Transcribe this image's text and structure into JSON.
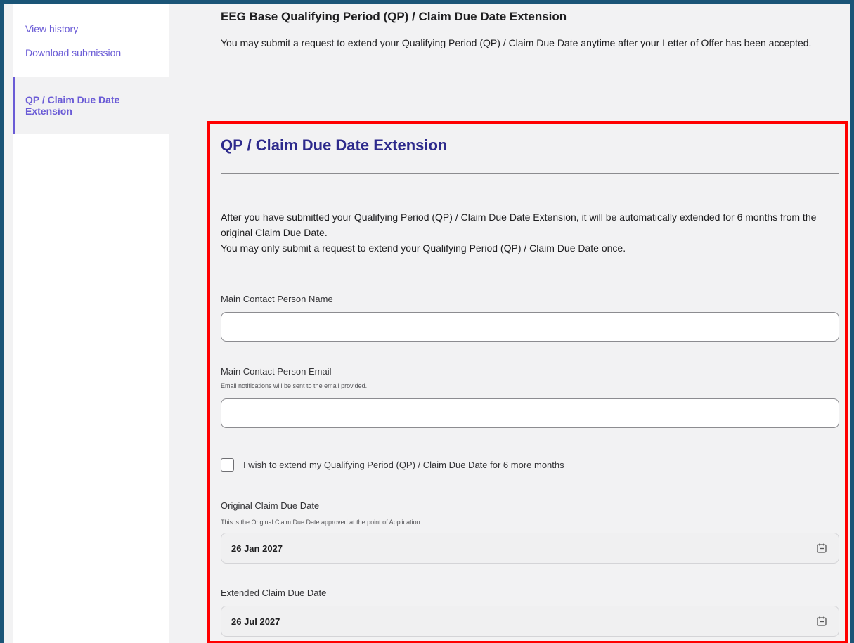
{
  "sidebar": {
    "links": [
      {
        "label": "View history"
      },
      {
        "label": "Download submission"
      }
    ],
    "active_item": {
      "label": "QP / Claim Due Date Extension"
    }
  },
  "header": {
    "title": "EEG Base Qualifying Period (QP) / Claim Due Date Extension",
    "description": "You may submit a request to extend your Qualifying Period (QP) / Claim Due Date anytime after your Letter of Offer has been accepted."
  },
  "form": {
    "title": "QP / Claim Due Date Extension",
    "intro": [
      "After you have submitted your Qualifying Period (QP) / Claim Due Date Extension, it will be automatically extended for 6 months from the original Claim Due Date.",
      "You may only submit a request to extend your Qualifying Period (QP) / Claim Due Date once."
    ],
    "contact_name": {
      "label": "Main Contact Person Name",
      "value": ""
    },
    "contact_email": {
      "label": "Main Contact Person Email",
      "hint": "Email notifications will be sent to the email provided.",
      "value": ""
    },
    "extend_checkbox": {
      "label": "I wish to extend my Qualifying Period (QP) / Claim Due Date for 6 more months",
      "checked": false
    },
    "original_date": {
      "label": "Original Claim Due Date",
      "hint": "This is the Original Claim Due Date approved at the point of Application",
      "value": "26 Jan 2027",
      "icon": "calendar-icon"
    },
    "extended_date": {
      "label": "Extended Claim Due Date",
      "value": "26 Jul 2027",
      "icon": "calendar-icon"
    }
  },
  "colors": {
    "accent": "#6a5bd6",
    "form_title": "#2d2a8c",
    "highlight_border": "#ff0000",
    "outer_frame": "#1b5577"
  }
}
